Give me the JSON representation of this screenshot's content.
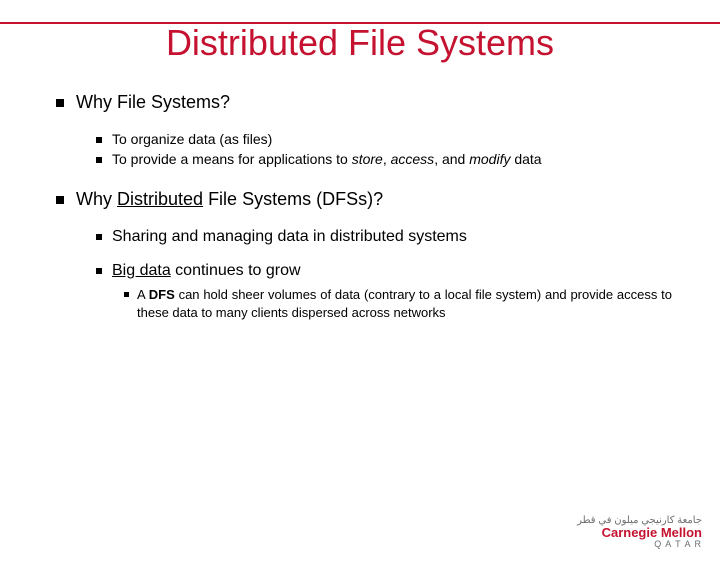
{
  "title": "Distributed File Systems",
  "section1": {
    "heading": "Why File Systems?",
    "items": {
      "a": "To organize data (as files)",
      "b_pre": "To provide a means for applications to ",
      "b_store": "store",
      "b_sep1": ", ",
      "b_access": "access",
      "b_sep2": ", and ",
      "b_modify": "modify",
      "b_post": " data"
    }
  },
  "section2": {
    "heading_pre": "Why ",
    "heading_u": "Distributed",
    "heading_post": " File Systems (DFSs)?",
    "item1": "Sharing and managing data in distributed systems",
    "item2_pre": "Big data",
    "item2_post": " continues to grow",
    "sub_pre": "A ",
    "sub_bold": "DFS",
    "sub_post": " can hold sheer volumes of data (contrary to a local file system) and provide access to these data to many clients dispersed across networks"
  },
  "logo": {
    "arabic": "جامعة كارنيجي ميلون في قطر",
    "name": "Carnegie Mellon",
    "loc": "Q A T A R"
  }
}
